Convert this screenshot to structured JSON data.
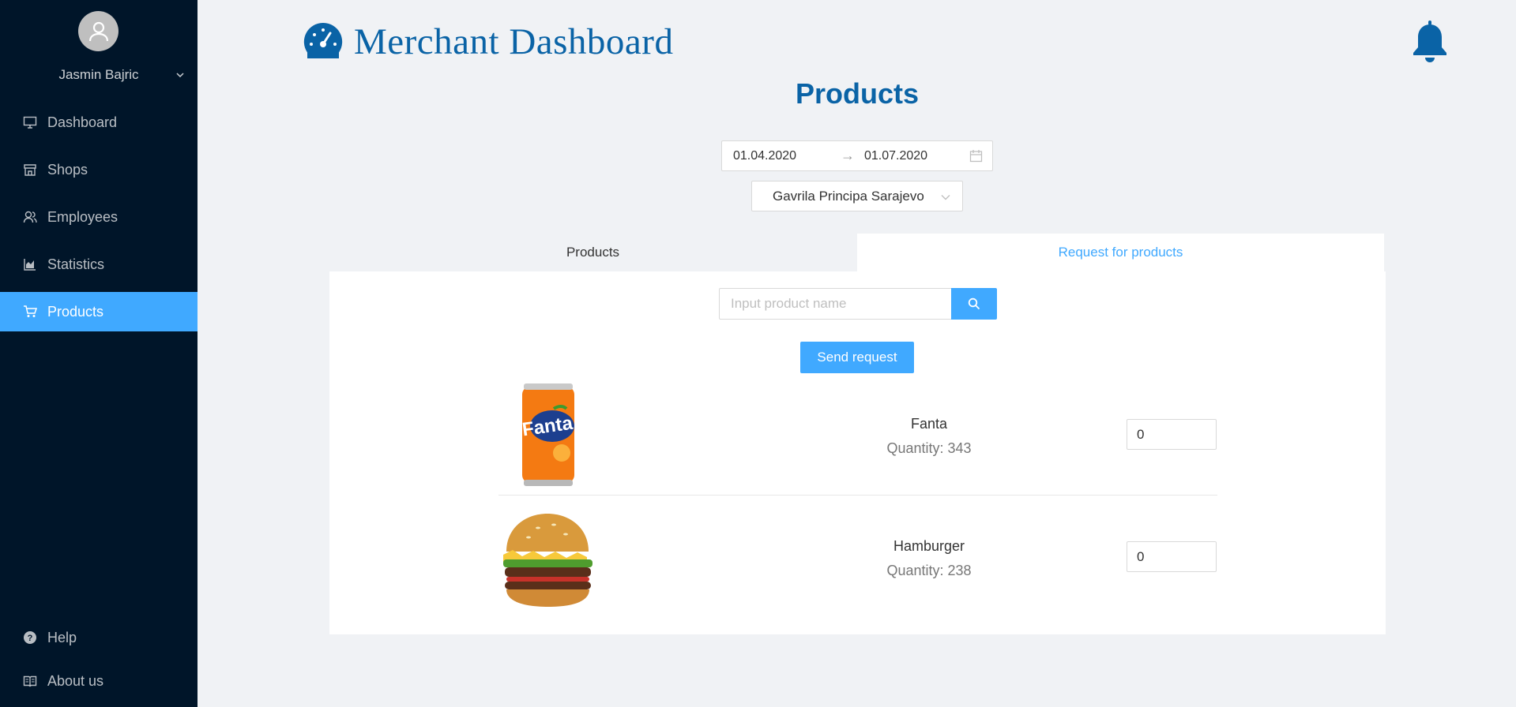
{
  "app": {
    "title": "Merchant Dashboard",
    "brand_color": "#0a63a6",
    "accent": "#40a9ff"
  },
  "user": {
    "name": "Jasmin Bajric"
  },
  "sidebar": {
    "items": [
      {
        "label": "Dashboard",
        "icon": "monitor-icon"
      },
      {
        "label": "Shops",
        "icon": "shop-icon"
      },
      {
        "label": "Employees",
        "icon": "users-icon"
      },
      {
        "label": "Statistics",
        "icon": "area-chart-icon"
      },
      {
        "label": "Products",
        "icon": "cart-icon",
        "active": true
      }
    ],
    "bottom": [
      {
        "label": "Help",
        "icon": "question-circle-icon"
      },
      {
        "label": "About us",
        "icon": "book-icon"
      }
    ]
  },
  "page": {
    "title": "Products"
  },
  "filters": {
    "date_from": "01.04.2020",
    "date_to": "01.07.2020",
    "date_separator": "→",
    "shop": "Gavrila Principa Sarajevo"
  },
  "tabs": [
    {
      "label": "Products",
      "active": false
    },
    {
      "label": "Request for products",
      "active": true
    }
  ],
  "search": {
    "placeholder": "Input product name",
    "value": ""
  },
  "actions": {
    "send_request": "Send request"
  },
  "products": [
    {
      "name": "Fanta",
      "quantity_label": "Quantity: 343",
      "request_value": "0"
    },
    {
      "name": "Hamburger",
      "quantity_label": "Quantity: 238",
      "request_value": "0"
    }
  ]
}
